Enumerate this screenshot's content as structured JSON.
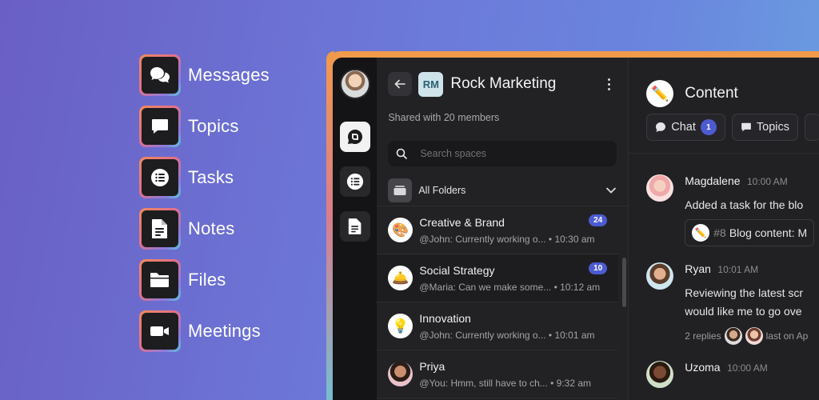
{
  "features": [
    {
      "label": "Messages",
      "icon": "chat-bubbles-icon"
    },
    {
      "label": "Topics",
      "icon": "speech-bubble-icon"
    },
    {
      "label": "Tasks",
      "icon": "task-list-icon"
    },
    {
      "label": "Notes",
      "icon": "document-icon"
    },
    {
      "label": "Files",
      "icon": "folder-icon"
    },
    {
      "label": "Meetings",
      "icon": "video-camera-icon"
    }
  ],
  "space": {
    "badge": "RM",
    "title": "Rock Marketing",
    "members": "Shared with 20 members"
  },
  "search": {
    "placeholder": "Search spaces"
  },
  "folders": {
    "label": "All Folders"
  },
  "spaces": [
    {
      "name": "Creative & Brand",
      "preview": "@John: Currently working o... • 10:30 am",
      "badge": "24",
      "emoji": "🎨"
    },
    {
      "name": "Social Strategy",
      "preview": "@Maria: Can we make some... • 10:12 am",
      "badge": "10",
      "emoji": "🛎️"
    },
    {
      "name": "Innovation",
      "preview": "@John: Currently working o... • 10:01 am",
      "badge": "",
      "emoji": "💡"
    },
    {
      "name": "Priya",
      "preview": "@You: Hmm, still have to ch... • 9:32 am",
      "badge": "",
      "emoji": ""
    }
  ],
  "content": {
    "title": "Content",
    "emoji": "✏️",
    "tabs": [
      {
        "label": "Chat",
        "badge": "1"
      },
      {
        "label": "Topics",
        "badge": ""
      }
    ]
  },
  "messages": [
    {
      "author": "Magdalene",
      "time": "10:00 AM",
      "text": "Added a task for the blo",
      "task_emoji": "✏️",
      "task_num": "#8",
      "task_text": "Blog content: M"
    },
    {
      "author": "Ryan",
      "time": "10:01 AM",
      "line1": "Reviewing the latest scr",
      "line2": "would like me to go ove",
      "replies": "2 replies",
      "last": "last on Ap"
    },
    {
      "author": "Uzoma",
      "time": "10:00 AM"
    }
  ],
  "colors": {
    "accent": "#4d5bd1",
    "panel": "#222225",
    "rail": "#141416"
  }
}
